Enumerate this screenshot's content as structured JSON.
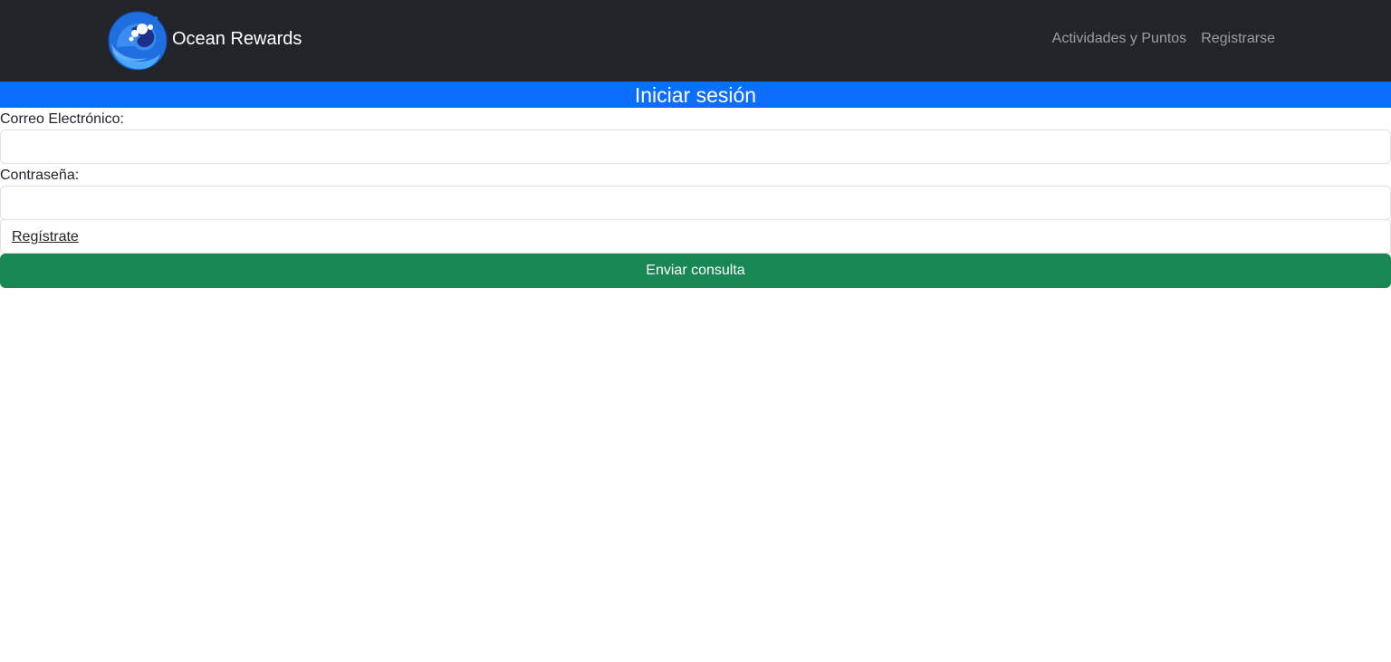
{
  "navbar": {
    "brand_name": "Ocean Rewards",
    "logo_icon": "ocean-wave-icon",
    "links": [
      {
        "label": "Actividades y Puntos"
      },
      {
        "label": "Registrarse"
      }
    ],
    "background_color": "#212529"
  },
  "page": {
    "title": "Iniciar sesión",
    "title_bar_color": "#0d6efd"
  },
  "form": {
    "email_label": "Correo Electrónico:",
    "email_value": "",
    "password_label": "Contraseña:",
    "password_value": "",
    "register_link_label": "Regístrate",
    "submit_label": "Enviar consulta",
    "submit_color": "#198754"
  }
}
